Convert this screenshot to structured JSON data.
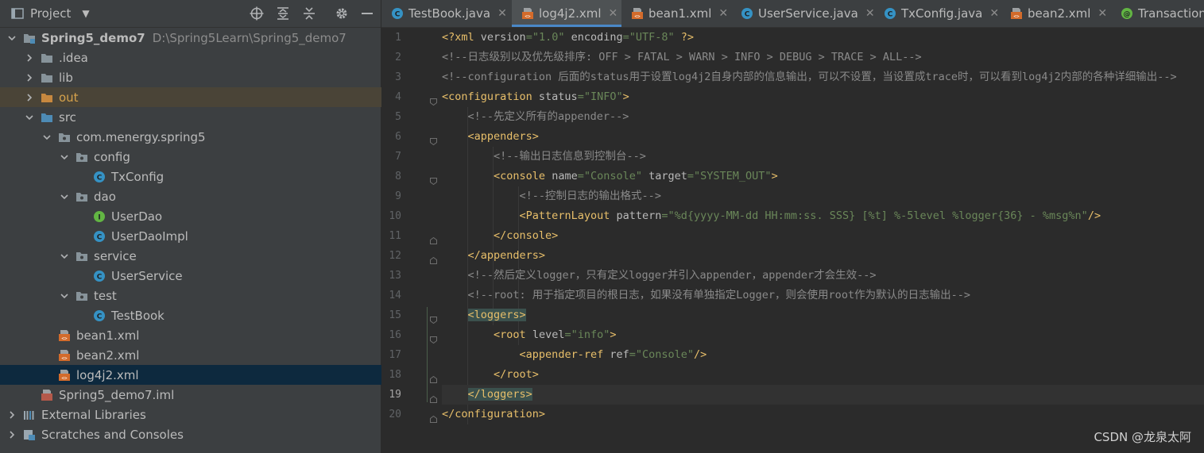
{
  "project_panel": {
    "title": "Project",
    "tree": [
      {
        "label": "Spring5_demo7",
        "path": "D:\\Spring5Learn\\Spring5_demo7",
        "icon": "module-folder-icon",
        "indent": 0,
        "expanded": true
      },
      {
        "label": ".idea",
        "icon": "folder-icon",
        "indent": 1,
        "expanded": false
      },
      {
        "label": "lib",
        "icon": "folder-icon",
        "indent": 1,
        "expanded": false
      },
      {
        "label": "out",
        "icon": "folder-orange-icon",
        "indent": 1,
        "expanded": false
      },
      {
        "label": "src",
        "icon": "source-folder-icon",
        "indent": 1,
        "expanded": true
      },
      {
        "label": "com.menergy.spring5",
        "icon": "package-icon",
        "indent": 2,
        "expanded": true
      },
      {
        "label": "config",
        "icon": "package-icon",
        "indent": 3,
        "expanded": true
      },
      {
        "label": "TxConfig",
        "icon": "class-icon",
        "indent": 4
      },
      {
        "label": "dao",
        "icon": "package-icon",
        "indent": 3,
        "expanded": true
      },
      {
        "label": "UserDao",
        "icon": "interface-icon",
        "indent": 4
      },
      {
        "label": "UserDaoImpl",
        "icon": "class-icon",
        "indent": 4
      },
      {
        "label": "service",
        "icon": "package-icon",
        "indent": 3,
        "expanded": true
      },
      {
        "label": "UserService",
        "icon": "class-icon",
        "indent": 4
      },
      {
        "label": "test",
        "icon": "package-icon",
        "indent": 3,
        "expanded": true
      },
      {
        "label": "TestBook",
        "icon": "class-icon",
        "indent": 4
      },
      {
        "label": "bean1.xml",
        "icon": "xml-icon",
        "indent": 2
      },
      {
        "label": "bean2.xml",
        "icon": "xml-icon",
        "indent": 2
      },
      {
        "label": "log4j2.xml",
        "icon": "xml-icon",
        "indent": 2,
        "selected": true
      },
      {
        "label": "Spring5_demo7.iml",
        "icon": "iml-icon",
        "indent": 1
      },
      {
        "label": "External Libraries",
        "icon": "libraries-icon",
        "indent": 0,
        "expanded": false
      },
      {
        "label": "Scratches and Consoles",
        "icon": "scratches-icon",
        "indent": 0,
        "expanded": false
      }
    ]
  },
  "tabs": [
    {
      "label": "TestBook.java",
      "icon": "class-icon",
      "active": false
    },
    {
      "label": "log4j2.xml",
      "icon": "xml-icon",
      "active": true
    },
    {
      "label": "bean1.xml",
      "icon": "xml-icon",
      "active": false
    },
    {
      "label": "UserService.java",
      "icon": "class-icon",
      "active": false
    },
    {
      "label": "TxConfig.java",
      "icon": "class-icon",
      "active": false
    },
    {
      "label": "bean2.xml",
      "icon": "xml-icon",
      "active": false
    },
    {
      "label": "Transaction",
      "icon": "annotation-icon",
      "active": false
    }
  ],
  "editor": {
    "current_line": 19,
    "lines": [
      {
        "n": "1",
        "html": "<span class='tk-pi'>&lt;?xml </span><span class='tk-attr'>version</span><span class='tk-val'>=\"1.0\" </span><span class='tk-attr'>encoding</span><span class='tk-val'>=\"UTF-8\" </span><span class='tk-pi'>?&gt;</span>"
      },
      {
        "n": "2",
        "html": "<span class='tk-com'>&lt;!--日志级别以及优先级排序: OFF &gt; FATAL &gt; WARN &gt; INFO &gt; DEBUG &gt; TRACE &gt; ALL--&gt;</span>"
      },
      {
        "n": "3",
        "html": "<span class='tk-com'>&lt;!--configuration 后面的status用于设置log4j2自身内部的信息输出，可以不设置，当设置成trace时，可以看到log4j2内部的各种详细输出--&gt;</span>"
      },
      {
        "n": "4",
        "html": "<span class='tk-tag'>&lt;configuration </span><span class='tk-attr'>status</span><span class='tk-val'>=\"INFO\"</span><span class='tk-tag'>&gt;</span>"
      },
      {
        "n": "5",
        "html": "    <span class='tk-com'>&lt;!--先定义所有的appender--&gt;</span>"
      },
      {
        "n": "6",
        "html": "    <span class='tk-tag'>&lt;appenders&gt;</span>"
      },
      {
        "n": "7",
        "html": "        <span class='tk-com'>&lt;!--输出日志信息到控制台--&gt;</span>"
      },
      {
        "n": "8",
        "html": "        <span class='tk-tag'>&lt;console </span><span class='tk-attr'>name</span><span class='tk-val'>=\"Console\" </span><span class='tk-attr'>target</span><span class='tk-val'>=\"SYSTEM_OUT\"</span><span class='tk-tag'>&gt;</span>"
      },
      {
        "n": "9",
        "html": "            <span class='tk-com'>&lt;!--控制日志的输出格式--&gt;</span>"
      },
      {
        "n": "10",
        "html": "            <span class='tk-tag'>&lt;PatternLayout </span><span class='tk-attr'>pattern</span><span class='tk-val'>=\"%d{yyyy-MM-dd HH:mm:ss. SSS} [%t] %-5level %logger{36} - %msg%n\"</span><span class='tk-tag'>/&gt;</span>"
      },
      {
        "n": "11",
        "html": "        <span class='tk-tag'>&lt;/console&gt;</span>"
      },
      {
        "n": "12",
        "html": "    <span class='tk-tag'>&lt;/appenders&gt;</span>"
      },
      {
        "n": "13",
        "html": "    <span class='tk-com'>&lt;!--然后定义logger，只有定义logger并引入appender，appender才会生效--&gt;</span>"
      },
      {
        "n": "14",
        "html": "    <span class='tk-com'>&lt;!--root: 用于指定项目的根日志，如果没有单独指定Logger，则会使用root作为默认的日志输出--&gt;</span>"
      },
      {
        "n": "15",
        "html": "    <span class='tk-tag hl-tag'>&lt;loggers&gt;</span>"
      },
      {
        "n": "16",
        "html": "        <span class='tk-tag'>&lt;root </span><span class='tk-attr'>level</span><span class='tk-val'>=\"info\"</span><span class='tk-tag'>&gt;</span>"
      },
      {
        "n": "17",
        "html": "            <span class='tk-tag'>&lt;appender-ref </span><span class='tk-attr'>ref</span><span class='tk-val'>=\"Console\"</span><span class='tk-tag'>/&gt;</span>"
      },
      {
        "n": "18",
        "html": "        <span class='tk-tag'>&lt;/root&gt;</span>"
      },
      {
        "n": "19",
        "html": "    <span class='tk-tag hl-tag'>&lt;/loggers&gt;</span>"
      },
      {
        "n": "20",
        "html": "<span class='tk-tag'>&lt;/configuration&gt;</span>"
      }
    ]
  },
  "watermark": "CSDN @龙泉太阿"
}
